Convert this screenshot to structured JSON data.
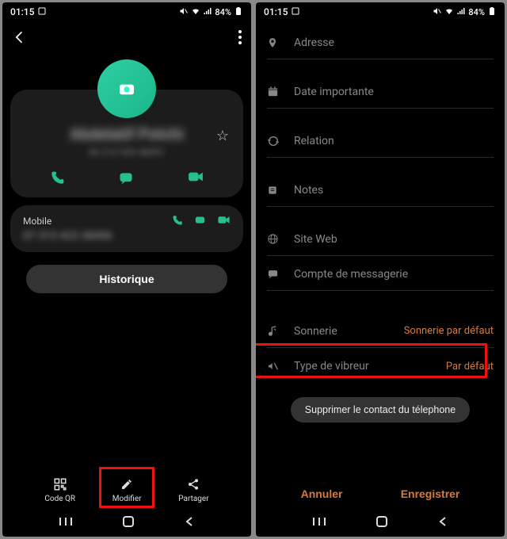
{
  "status": {
    "time": "01:15",
    "battery": "84%"
  },
  "left": {
    "contact_name": "Abdelatif Potchi",
    "contact_sub": "06 212 920 48491",
    "number_label": "Mobile",
    "number_value": "07 313 423 38496",
    "history_btn": "Historique",
    "bottom": {
      "qr": "Code QR",
      "edit": "Modifier",
      "share": "Partager"
    }
  },
  "right": {
    "fields": {
      "address": "Adresse",
      "date": "Date importante",
      "relation": "Relation",
      "notes": "Notes",
      "website": "Site Web",
      "email": "Compte de messagerie",
      "ringtone_label": "Sonnerie",
      "ringtone_value": "Sonnerie par défaut",
      "vibration_label": "Type de vibreur",
      "vibration_value": "Par défaut"
    },
    "delete_btn": "Supprimer le contact du télephone",
    "cancel": "Annuler",
    "save": "Enregistrer"
  }
}
